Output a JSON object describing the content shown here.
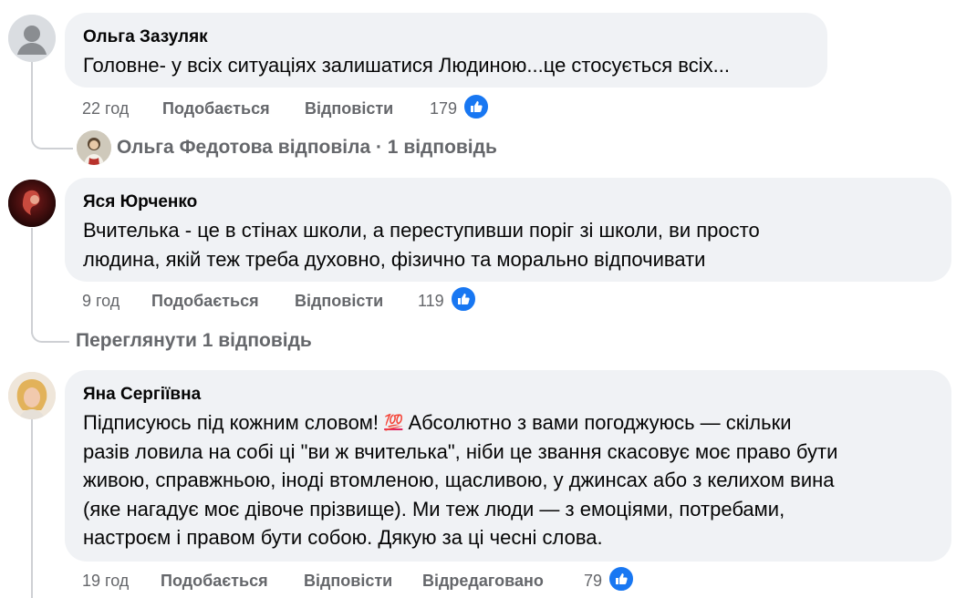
{
  "comments": [
    {
      "author": "Ольга Зазуляк",
      "text": "Головне- у всіх ситуаціях залишатися Людиною...це стосується всіх...",
      "time": "22 год",
      "like_label": "Подобається",
      "reply_label": "Відповісти",
      "reactions": "179",
      "reply_summary": {
        "text": "Ольга Федотова відповіла · 1 відповідь"
      }
    },
    {
      "author": "Яся Юрченко",
      "text_lines": [
        "Вчителька - це в стінах школи, а переступивши поріг зі школи, ви просто",
        "людина, якій теж треба духовно, фізично та морально відпочивати"
      ],
      "time": "9 год",
      "like_label": "Подобається",
      "reply_label": "Відповісти",
      "reactions": "119",
      "view_replies": "Переглянути 1 відповідь"
    },
    {
      "author": "Яна Сергіївна",
      "text_lines": [
        "Підписуюсь під кожним словом!",
        "Абсолютно з вами погоджуюсь — скільки",
        "разів ловила на собі ці \"ви ж вчителька\", ніби це звання скасовує моє право бути",
        "живою, справжньою, іноді втомленою, щасливою, у джинсах або з келихом вина",
        "(яке нагадує моє дівоче прізвище). Ми теж люди — з емоціями, потребами,",
        "настроєм і правом бути собою. Дякую за ці чесні слова."
      ],
      "emoji": "💯",
      "time": "19 год",
      "like_label": "Подобається",
      "reply_label": "Відповісти",
      "edited_label": "Відредаговано",
      "reactions": "79"
    }
  ],
  "icons": {
    "like": "thumbs-up-icon",
    "default_avatar": "default-avatar-icon"
  },
  "colors": {
    "bubble": "#f0f2f5",
    "muted_text": "#65676b",
    "like_blue": "#1877f2",
    "thread_line": "#ced0d4"
  }
}
